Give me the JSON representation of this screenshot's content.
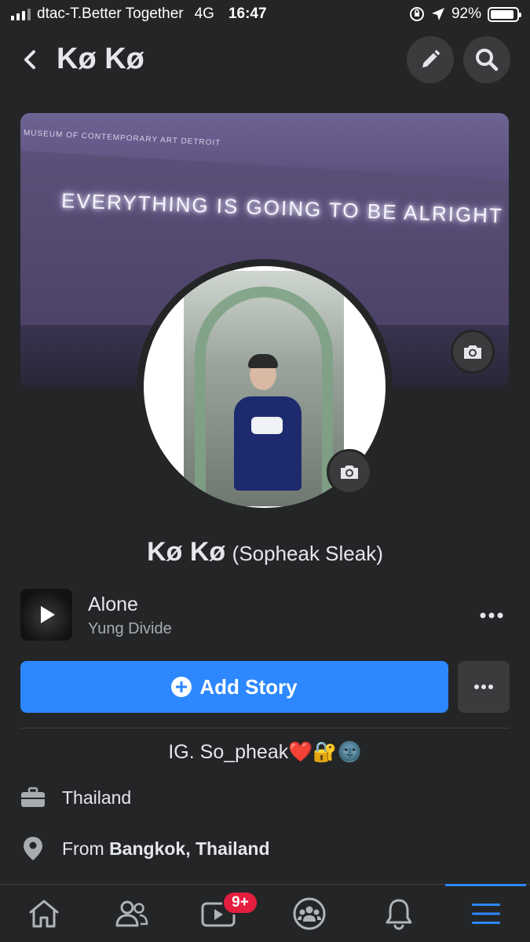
{
  "status_bar": {
    "carrier": "dtac-T.Better Together",
    "network": "4G",
    "time": "16:47",
    "battery_text": "92%",
    "battery_level": 0.92
  },
  "header": {
    "title": "Kø Kø"
  },
  "cover": {
    "roof_text": "MUSEUM OF CONTEMPORARY ART DETROIT",
    "neon_text": "EVERYTHING IS GOING TO BE ALRIGHT"
  },
  "profile": {
    "name": "Kø Kø",
    "alt_name": "(Sopheak Sleak)"
  },
  "music": {
    "title": "Alone",
    "artist": "Yung Divide"
  },
  "actions": {
    "add_story_label": "Add Story"
  },
  "bio": "IG. So_pheak❤️🔐🌚",
  "details": {
    "work": "Thailand",
    "from_prefix": "From ",
    "from_place": "Bangkok, Thailand"
  },
  "tabbar": {
    "watch_badge": "9+",
    "active_tab": "menu"
  },
  "colors": {
    "background": "#242526",
    "accent": "#2d88ff",
    "badge": "#e41e3f",
    "button_gray": "#3a3b3c"
  }
}
